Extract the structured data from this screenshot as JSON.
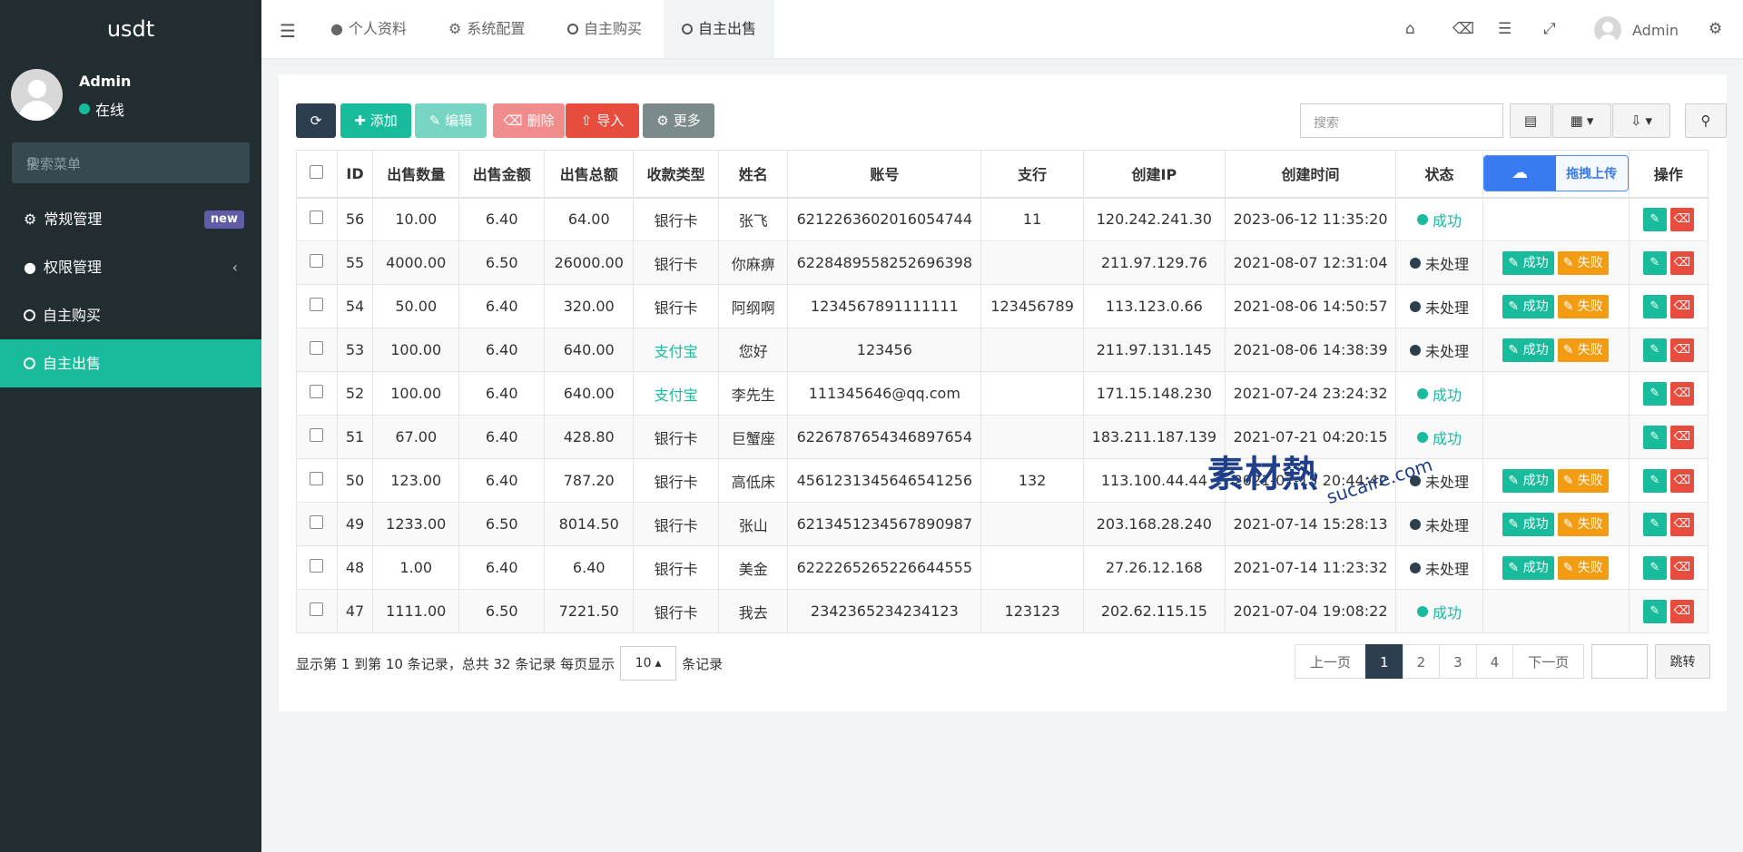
{
  "sidebar": {
    "brand": "usdt",
    "user": {
      "name": "Admin",
      "status": "在线"
    },
    "search_placeholder": "搜索菜单",
    "items": [
      {
        "label": "常规管理",
        "badge": "new"
      },
      {
        "label": "权限管理"
      },
      {
        "label": "自主购买"
      },
      {
        "label": "自主出售"
      }
    ]
  },
  "header": {
    "tabs": [
      "个人资料",
      "系统配置",
      "自主购买",
      "自主出售"
    ],
    "user": "Admin"
  },
  "toolbar": {
    "add": "添加",
    "edit": "编辑",
    "delete": "删除",
    "import": "导入",
    "more": "更多",
    "search_placeholder": "搜索"
  },
  "table": {
    "columns": [
      "ID",
      "出售数量",
      "出售金额",
      "出售总额",
      "收款类型",
      "姓名",
      "账号",
      "支行",
      "创建IP",
      "创建时间",
      "状态",
      "操作"
    ],
    "upload_label": "拖拽上传",
    "action_success": "成功",
    "action_fail": "失败",
    "rows": [
      {
        "id": "56",
        "qty": "10.00",
        "price": "6.40",
        "total": "64.00",
        "type": "银行卡",
        "name": "张飞",
        "account": "6212263602016054744",
        "branch": "11",
        "ip": "120.242.241.30",
        "time": "2023-06-12 11:35:20",
        "status": "成功"
      },
      {
        "id": "55",
        "qty": "4000.00",
        "price": "6.50",
        "total": "26000.00",
        "type": "银行卡",
        "name": "你麻痹",
        "account": "6228489558252696398",
        "branch": "",
        "ip": "211.97.129.76",
        "time": "2021-08-07 12:31:04",
        "status": "未处理"
      },
      {
        "id": "54",
        "qty": "50.00",
        "price": "6.40",
        "total": "320.00",
        "type": "银行卡",
        "name": "阿纲啊",
        "account": "1234567891111111",
        "branch": "123456789",
        "ip": "113.123.0.66",
        "time": "2021-08-06 14:50:57",
        "status": "未处理"
      },
      {
        "id": "53",
        "qty": "100.00",
        "price": "6.40",
        "total": "640.00",
        "type": "支付宝",
        "name": "您好",
        "account": "123456",
        "branch": "",
        "ip": "211.97.131.145",
        "time": "2021-08-06 14:38:39",
        "status": "未处理"
      },
      {
        "id": "52",
        "qty": "100.00",
        "price": "6.40",
        "total": "640.00",
        "type": "支付宝",
        "name": "李先生",
        "account": "111345646@qq.com",
        "branch": "",
        "ip": "171.15.148.230",
        "time": "2021-07-24 23:24:32",
        "status": "成功"
      },
      {
        "id": "51",
        "qty": "67.00",
        "price": "6.40",
        "total": "428.80",
        "type": "银行卡",
        "name": "巨蟹座",
        "account": "6226787654346897654",
        "branch": "",
        "ip": "183.211.187.139",
        "time": "2021-07-21 04:20:15",
        "status": "成功"
      },
      {
        "id": "50",
        "qty": "123.00",
        "price": "6.40",
        "total": "787.20",
        "type": "银行卡",
        "name": "高低床",
        "account": "4561231345646541256",
        "branch": "132",
        "ip": "113.100.44.44",
        "time": "2021-07-15 20:44:42",
        "status": "未处理"
      },
      {
        "id": "49",
        "qty": "1233.00",
        "price": "6.50",
        "total": "8014.50",
        "type": "银行卡",
        "name": "张山",
        "account": "6213451234567890987",
        "branch": "",
        "ip": "203.168.28.240",
        "time": "2021-07-14 15:28:13",
        "status": "未处理"
      },
      {
        "id": "48",
        "qty": "1.00",
        "price": "6.40",
        "total": "6.40",
        "type": "银行卡",
        "name": "美金",
        "account": "6222265265226644555",
        "branch": "",
        "ip": "27.26.12.168",
        "time": "2021-07-14 11:23:32",
        "status": "未处理"
      },
      {
        "id": "47",
        "qty": "1111.00",
        "price": "6.50",
        "total": "7221.50",
        "type": "银行卡",
        "name": "我去",
        "account": "2342365234234123",
        "branch": "123123",
        "ip": "202.62.115.15",
        "time": "2021-07-04 19:08:22",
        "status": "成功"
      }
    ]
  },
  "footer": {
    "info": "显示第 1 到第 10 条记录，总共 32 条记录 每页显示",
    "page_size": "10",
    "info_suffix": "条记录",
    "prev": "上一页",
    "pages": [
      "1",
      "2",
      "3",
      "4"
    ],
    "next": "下一页",
    "jump": "跳转"
  },
  "watermark": {
    "main": "素材熱",
    "site": "sucaire.com"
  },
  "colors": {
    "sidebar": "#222d32",
    "accent": "#18bc9c",
    "dark": "#2c3e50",
    "danger": "#e74c3c",
    "warning": "#f39c12"
  }
}
